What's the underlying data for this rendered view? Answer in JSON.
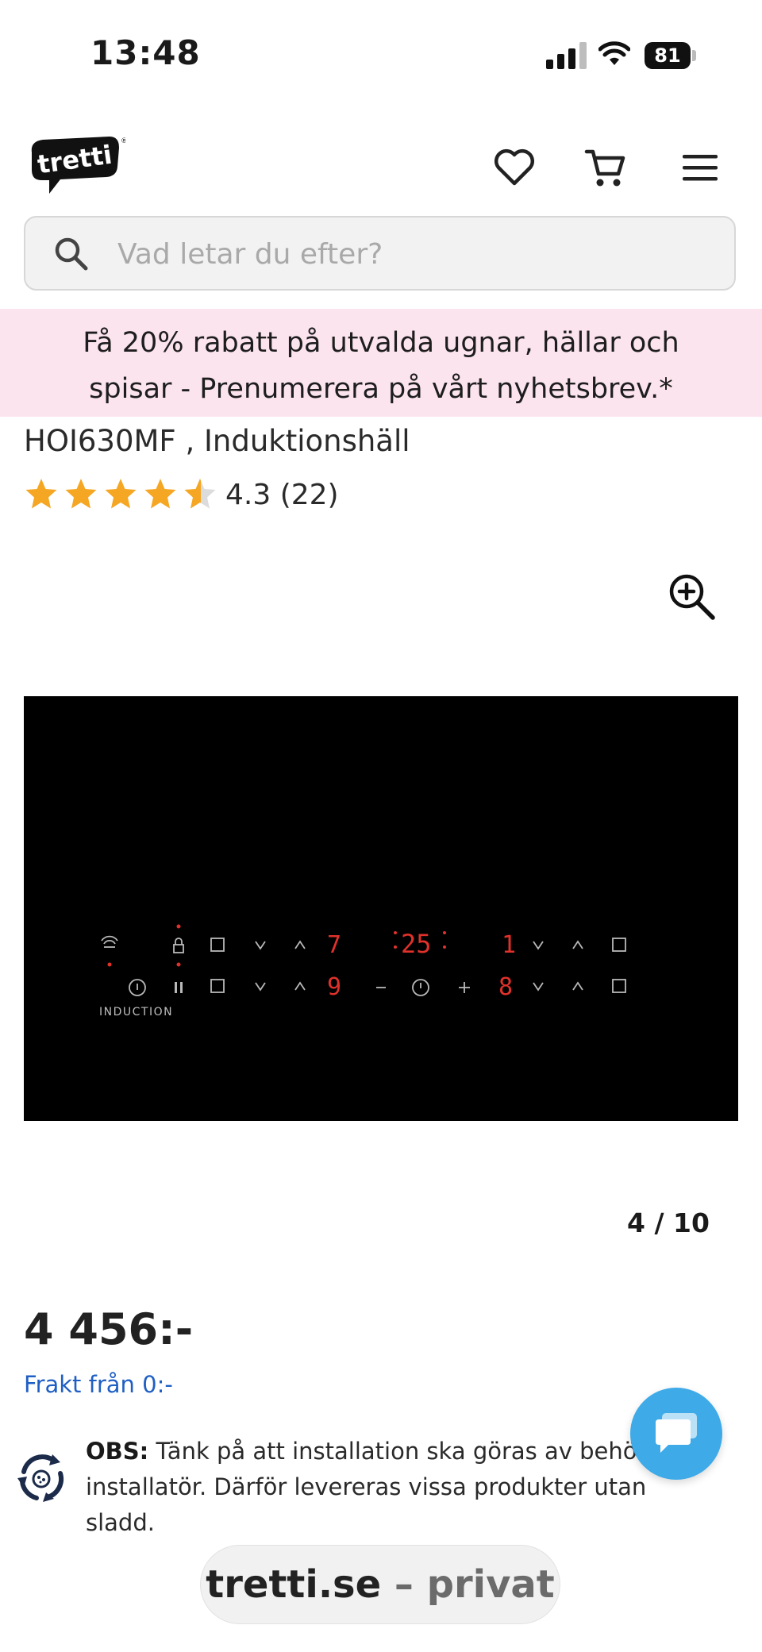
{
  "status_bar": {
    "time": "13:48",
    "battery": "81"
  },
  "header": {
    "logo_text": "tretti",
    "icons": [
      "heart-icon",
      "cart-icon",
      "menu-icon"
    ]
  },
  "search": {
    "placeholder": "Vad letar du efter?"
  },
  "promo": {
    "text": "Få 20% rabatt på utvalda ugnar, hällar och spisar - Prenumerera på vårt nyhetsbrev.*"
  },
  "product": {
    "title": "HOI630MF , Induktionshäll",
    "rating": 4.3,
    "rating_text": "4.3 (22)",
    "image_label": "INDUCTION",
    "display_top_left": "7",
    "display_bottom_left": "9",
    "display_timer": "25",
    "display_top_right": "1",
    "display_bottom_right": "8",
    "pager": "4 / 10",
    "price": "4 456:-",
    "shipping": "Frakt från 0:-"
  },
  "notice": {
    "label": "OBS:",
    "text": " Tänk på att installation ska göras av behörig installatör. Därför levereras vissa produkter utan sladd."
  },
  "browser": {
    "domain": "tretti.se",
    "separator": " – ",
    "section": "privat"
  },
  "colors": {
    "promo_bg": "#fce4ef",
    "star": "#f5a623",
    "link": "#1f5fc4",
    "chat": "#3eaae8",
    "display_red": "#e0312b"
  }
}
